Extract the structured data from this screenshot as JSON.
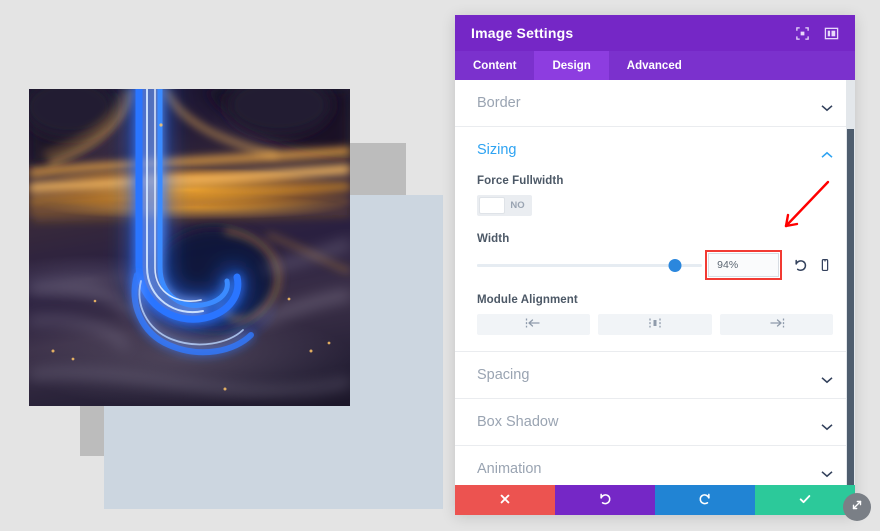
{
  "panel": {
    "title": "Image Settings",
    "header_icons": [
      {
        "name": "fullscreen-icon"
      },
      {
        "name": "panel-layout-icon"
      }
    ],
    "tabs": [
      {
        "label": "Content",
        "active": false
      },
      {
        "label": "Design",
        "active": true
      },
      {
        "label": "Advanced",
        "active": false
      }
    ],
    "sections": [
      {
        "label": "Border",
        "open": false
      },
      {
        "label": "Sizing",
        "open": true
      },
      {
        "label": "Spacing",
        "open": false
      },
      {
        "label": "Box Shadow",
        "open": false
      },
      {
        "label": "Animation",
        "open": false
      }
    ],
    "sizing": {
      "force_fullwidth": {
        "label": "Force Fullwidth",
        "toggle_value": "NO",
        "state": "off"
      },
      "width": {
        "label": "Width",
        "value": "94%",
        "placeholder": "",
        "slider_percent": 88,
        "reset_icon": "undo-icon",
        "responsive_icon": "mobile-device-icon"
      },
      "module_alignment": {
        "label": "Module Alignment",
        "options": [
          {
            "name": "align-left-button",
            "icon": "align-left-icon"
          },
          {
            "name": "align-center-button",
            "icon": "align-center-icon"
          },
          {
            "name": "align-right-button",
            "icon": "align-right-icon"
          }
        ]
      }
    },
    "footer": [
      {
        "name": "cancel-button",
        "icon": "close-icon",
        "color": "#ec5350"
      },
      {
        "name": "undo-button",
        "icon": "undo-icon",
        "color": "#7527c6"
      },
      {
        "name": "redo-button",
        "icon": "redo-icon",
        "color": "#2184d4"
      },
      {
        "name": "save-button",
        "icon": "checkmark-icon",
        "color": "#2cc99a"
      }
    ],
    "scrollbar": {
      "thumb_top_percent": 12,
      "thumb_height_percent": 88
    }
  },
  "canvas": {
    "image_alt": "Aerial night photo of a highway interchange with blue and orange light trails",
    "shapes": [
      {
        "name": "gray-rectangle",
        "color": "#bcbcbc"
      },
      {
        "name": "blue-gray-rectangle",
        "color": "#ccd6e0"
      }
    ],
    "background_color": "#e4e4e4"
  },
  "annotation": {
    "arrow_color": "#ff0000",
    "highlight_color": "#f23a33",
    "target": "width-value-input"
  },
  "resize_handle": {
    "name": "panel-resize-handle",
    "icon": "resize-diagonal-icon"
  }
}
